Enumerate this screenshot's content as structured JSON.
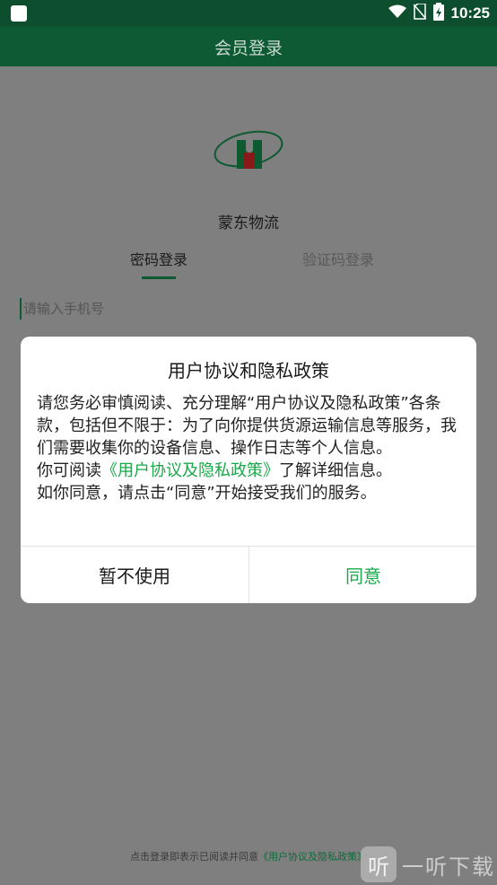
{
  "status_bar": {
    "time": "10:25",
    "icons": [
      "app-notification-icon",
      "wifi-icon",
      "no-sim-icon",
      "battery-icon"
    ]
  },
  "app_bar": {
    "title": "会员登录"
  },
  "brand": {
    "name": "蒙东物流",
    "logo_colors": {
      "green": "#0d7a3a",
      "red": "#b02020"
    }
  },
  "login_tabs": [
    {
      "label": "密码登录",
      "active": true
    },
    {
      "label": "验证码登录",
      "active": false
    }
  ],
  "phone_input": {
    "placeholder": "请输入手机号",
    "value": ""
  },
  "footer": {
    "agree_prefix": "点击登录即表示已阅读并同意",
    "agree_link": "《用户协议及隐私政策》"
  },
  "watermark": {
    "badge": "听",
    "text": "一听下载"
  },
  "dialog": {
    "title": "用户协议和隐私政策",
    "paragraph1": "请您务必审慎阅读、充分理解“用户协议及隐私政策”各条款，包括但不限于：为了向你提供货源运输信息等服务，我们需要收集你的设备信息、操作日志等个人信息。",
    "paragraph2_prefix": "你可阅读",
    "paragraph2_link": "《用户协议及隐私政策》",
    "paragraph2_suffix": "了解详细信息。",
    "paragraph3": "如你同意，请点击“同意”开始接受我们的服务。",
    "decline_label": "暂不使用",
    "agree_label": "同意"
  },
  "colors": {
    "primary_dark": "#0d4e2e",
    "primary": "#0d5a35",
    "accent_green": "#1aa84a",
    "overlay": "#7f7f7f"
  }
}
